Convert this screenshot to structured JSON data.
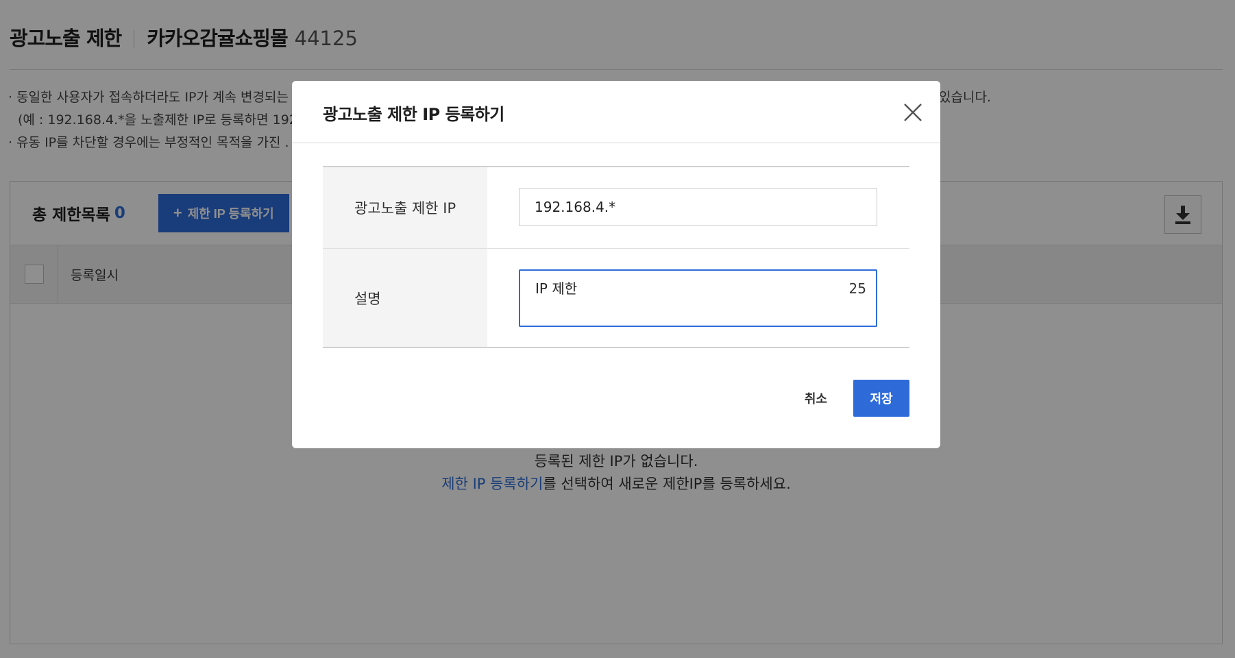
{
  "header": {
    "title": "광고노출 제한",
    "shop_name": "카카오감귤쇼핑몰",
    "shop_id": "44125"
  },
  "notice": {
    "line1": "· 동일한 사용자가 접속하더라도 IP가 계속 변경되는",
    "line1_tail": "있습니다.",
    "line2": "(예 : 192.168.4.*을 노출제한 IP로 등록하면 192.",
    "line3": "· 유동 IP를 차단할 경우에는 부정적인 목적을 가진 ."
  },
  "panel": {
    "total_label": "총 제한목록",
    "total_count": "0",
    "register_button": "제한 IP 등록하기",
    "register_plus": "+",
    "table_header_date": "등록일시",
    "empty_line1": "등록된 제한 IP가 없습니다.",
    "empty_link": "제한 IP 등록하기",
    "empty_line2_tail": "를 선택하여 새로운 제한IP를 등록하세요."
  },
  "modal": {
    "title": "광고노출 제한 IP 등록하기",
    "ip_label": "광고노출 제한 IP",
    "ip_value": "192.168.4.*",
    "desc_label": "설명",
    "desc_value": "IP 제한",
    "desc_char_count": "25",
    "cancel_label": "취소",
    "save_label": "저장"
  },
  "icons": {
    "download": "download-icon",
    "close": "close-icon",
    "plus": "plus-icon"
  },
  "colors": {
    "accent": "#2e6bd9",
    "link": "#2f6fd6"
  }
}
